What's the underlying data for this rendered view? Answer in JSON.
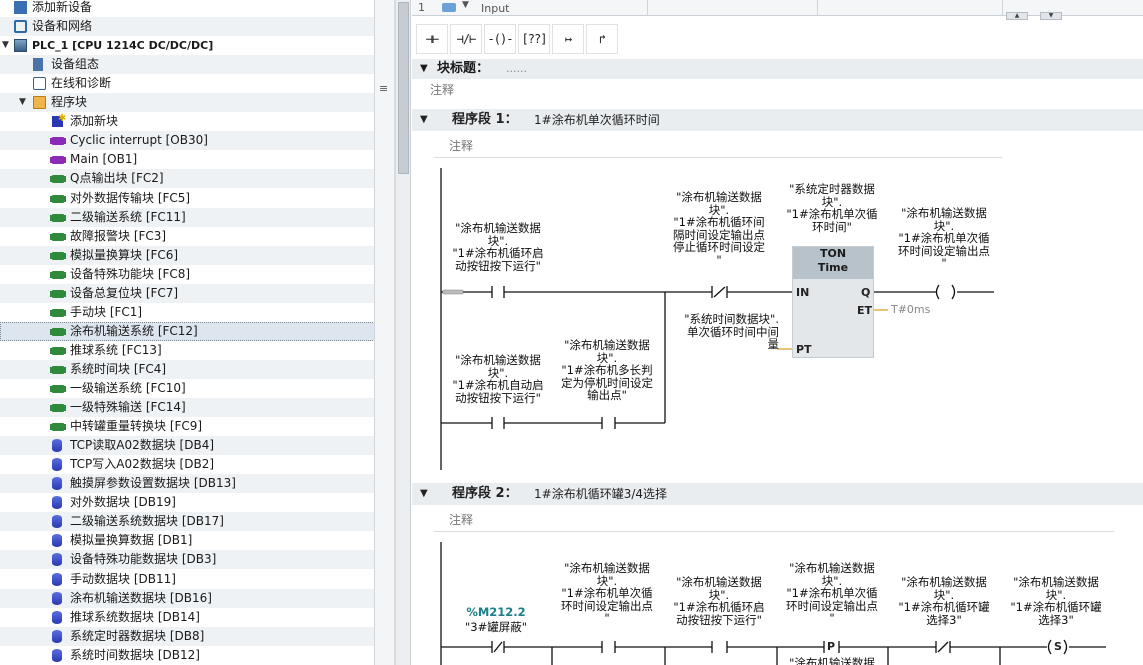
{
  "tree": {
    "items": [
      {
        "label": "添加新设备",
        "icon": "add-device-icon",
        "level": 0
      },
      {
        "label": "设备和网络",
        "icon": "network-icon",
        "level": 0
      },
      {
        "label": "PLC_1 [CPU 1214C DC/DC/DC]",
        "icon": "plc-icon",
        "level": 0
      },
      {
        "label": "设备组态",
        "icon": "device-config-icon",
        "level": 1
      },
      {
        "label": "在线和诊断",
        "icon": "diagnostics-icon",
        "level": 1
      },
      {
        "label": "程序块",
        "icon": "folder-icon",
        "level": 1
      },
      {
        "label": "添加新块",
        "icon": "add-block-icon",
        "level": 2
      },
      {
        "label": "Cyclic interrupt [OB30]",
        "icon": "ob-icon",
        "level": 2
      },
      {
        "label": "Main [OB1]",
        "icon": "ob-icon",
        "level": 2
      },
      {
        "label": "Q点输出块 [FC2]",
        "icon": "fc-icon",
        "level": 2
      },
      {
        "label": "对外数据传输块 [FC5]",
        "icon": "fc-icon",
        "level": 2
      },
      {
        "label": "二级输送系统 [FC11]",
        "icon": "fc-icon",
        "level": 2
      },
      {
        "label": "故障报警块 [FC3]",
        "icon": "fc-icon",
        "level": 2
      },
      {
        "label": "模拟量换算块 [FC6]",
        "icon": "fc-icon",
        "level": 2
      },
      {
        "label": "设备特殊功能块 [FC8]",
        "icon": "fc-icon",
        "level": 2
      },
      {
        "label": "设备总复位块 [FC7]",
        "icon": "fc-icon",
        "level": 2
      },
      {
        "label": "手动块 [FC1]",
        "icon": "fc-icon",
        "level": 2
      },
      {
        "label": "涂布机输送系统 [FC12]",
        "icon": "fc-icon",
        "level": 2
      },
      {
        "label": "推球系统 [FC13]",
        "icon": "fc-icon",
        "level": 2
      },
      {
        "label": "系统时间块 [FC4]",
        "icon": "fc-icon",
        "level": 2
      },
      {
        "label": "一级输送系统 [FC10]",
        "icon": "fc-icon",
        "level": 2
      },
      {
        "label": "一级特殊输送 [FC14]",
        "icon": "fc-icon",
        "level": 2
      },
      {
        "label": "中转罐重量转换块 [FC9]",
        "icon": "fc-icon",
        "level": 2
      },
      {
        "label": "TCP读取A02数据块 [DB4]",
        "icon": "db-icon",
        "level": 2
      },
      {
        "label": "TCP写入A02数据块 [DB2]",
        "icon": "db-icon",
        "level": 2
      },
      {
        "label": "触摸屏参数设置数据块 [DB13]",
        "icon": "db-icon",
        "level": 2
      },
      {
        "label": "对外数据块 [DB19]",
        "icon": "db-icon",
        "level": 2
      },
      {
        "label": "二级输送系统数据块 [DB17]",
        "icon": "db-icon",
        "level": 2
      },
      {
        "label": "模拟量换算数据 [DB1]",
        "icon": "db-icon",
        "level": 2
      },
      {
        "label": "设备特殊功能数据块 [DB3]",
        "icon": "db-icon",
        "level": 2
      },
      {
        "label": "手动数据块 [DB11]",
        "icon": "db-icon",
        "level": 2
      },
      {
        "label": "涂布机输送数据块 [DB16]",
        "icon": "db-icon",
        "level": 2
      },
      {
        "label": "推球系统数据块 [DB14]",
        "icon": "db-icon",
        "level": 2
      },
      {
        "label": "系统定时器数据块 [DB8]",
        "icon": "db-icon",
        "level": 2
      },
      {
        "label": "系统时间数据块 [DB12]",
        "icon": "db-icon",
        "level": 2
      }
    ],
    "selected_index": 17
  },
  "splitter": {
    "grip": "≡"
  },
  "interface": {
    "row_number": "1",
    "dropdown": "▼",
    "name": "Input",
    "scroll_up": "▲",
    "scroll_down": "▼"
  },
  "toolbar": {
    "buttons": [
      {
        "label": "⊣⊢",
        "name": "no-contact-button"
      },
      {
        "label": "⊣/⊢",
        "name": "nc-contact-button"
      },
      {
        "label": "-()-",
        "name": "coil-button"
      },
      {
        "label": "[??]",
        "name": "empty-box-button"
      },
      {
        "label": "↦",
        "name": "open-branch-button"
      },
      {
        "label": "↱",
        "name": "close-branch-button"
      }
    ]
  },
  "block": {
    "title_label": "块标题：",
    "title_value": "......",
    "comment": "注释"
  },
  "networks": [
    {
      "title": "程序段 1：",
      "description": "1#涂布机单次循环时间",
      "comment": "注释",
      "operands": {
        "start_button": "\"涂布机输送数据\n块\".\n\"1#涂布机循环启\n动按钮按下运行\"",
        "interval_stop": "\"涂布机输送数据\n块\".\n\"1#涂布机循环间\n隔时间设定输出点\n停止循环时间设定\n\"",
        "timer_db": "\"系统定时器数据\n块\".\n\"1#涂布机单次循\n环时间\"",
        "coil": "\"涂布机输送数据\n块\".\n\"1#涂布机单次循\n环时间设定输出点\n\"",
        "pt": "\"系统时间数据块\".\n单次循环时间中间\n量",
        "auto_button": "\"涂布机输送数据\n块\".\n\"1#涂布机自动启\n动按钮按下运行\"",
        "judge": "\"涂布机输送数据\n块\".\n\"1#涂布机多长判\n定为停机时间设定\n输出点\""
      },
      "timer": {
        "type": "TON",
        "subtype": "Time",
        "in": "IN",
        "q": "Q",
        "et": "ET",
        "pt": "PT",
        "et_value": "T#0ms"
      }
    },
    {
      "title": "程序段 2：",
      "description": "1#涂布机循环罐3/4选择",
      "comment": "注释",
      "operands": {
        "m_address": "%M212.2",
        "m_name": "\"3#罐屏蔽\"",
        "op2": "\"涂布机输送数据\n块\".\n\"1#涂布机单次循\n环时间设定输出点\n\"",
        "op3": "\"涂布机输送数据\n块\".\n\"1#涂布机循环启\n动按钮按下运行\"",
        "op4": "\"涂布机输送数据\n块\".\n\"1#涂布机单次循\n环时间设定输出点\n\"",
        "op5": "\"涂布机输送数据\n块\".\n\"1#涂布机循环罐\n选择3\"",
        "op6": "\"涂布机输送数据\n块\".\n\"1#涂布机循环罐\n选择3\"",
        "op_bottom": "\"涂布机输送数据"
      },
      "p_contact": "P",
      "set_coil": "S"
    }
  ]
}
